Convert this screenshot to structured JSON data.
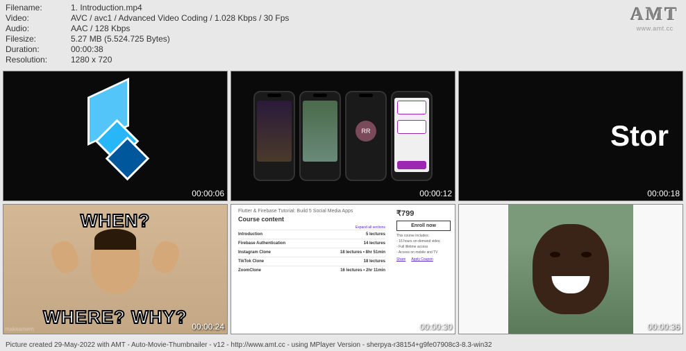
{
  "header": {
    "filename_label": "Filename:",
    "filename_value": "1. Introduction.mp4",
    "video_label": "Video:",
    "video_value": "AVC / avc1 / Advanced Video Coding / 1.028 Kbps / 30 Fps",
    "audio_label": "Audio:",
    "audio_value": "AAC / 128 Kbps",
    "filesize_label": "Filesize:",
    "filesize_value": "5.27 MB (5.524.725 Bytes)",
    "duration_label": "Duration:",
    "duration_value": "00:00:38",
    "resolution_label": "Resolution:",
    "resolution_value": "1280 x 720"
  },
  "logo": {
    "text": "AMT",
    "url": "www.amt.cc"
  },
  "thumbs": {
    "t1": {
      "ts": "00:00:06"
    },
    "t2": {
      "ts": "00:00:12",
      "rr": "RR"
    },
    "t3": {
      "ts": "00:00:18",
      "text": "Stor"
    },
    "t4": {
      "ts": "00:00:24",
      "top": "WHEN?",
      "bot": "WHERE? WHY?",
      "wm": "makeamem"
    },
    "t5": {
      "ts": "00:00:30",
      "title": "Flutter & Firebase Tutorial: Build 5 Social Media Apps",
      "heading": "Course content",
      "expand": "Expand all sections",
      "rows": [
        {
          "name": "Introduction",
          "info": "5 lectures"
        },
        {
          "name": "Firebase Authentication",
          "info": "14 lectures"
        },
        {
          "name": "Instagram Clone",
          "info": "18 lectures • 8hr 51min"
        },
        {
          "name": "TikTok Clone",
          "info": "18 lectures"
        },
        {
          "name": "ZoomClone",
          "info": "16 lectures • 2hr 11min"
        }
      ],
      "price": "₹799",
      "enroll": "Enroll now",
      "includes": "This course includes:",
      "share": "Share",
      "apply": "Apply Coupon"
    },
    "t6": {
      "ts": "00:00:36"
    }
  },
  "footer": "Picture created 29-May-2022 with AMT - Auto-Movie-Thumbnailer - v12 - http://www.amt.cc - using MPlayer Version - sherpya-r38154+g9fe07908c3-8.3-win32"
}
